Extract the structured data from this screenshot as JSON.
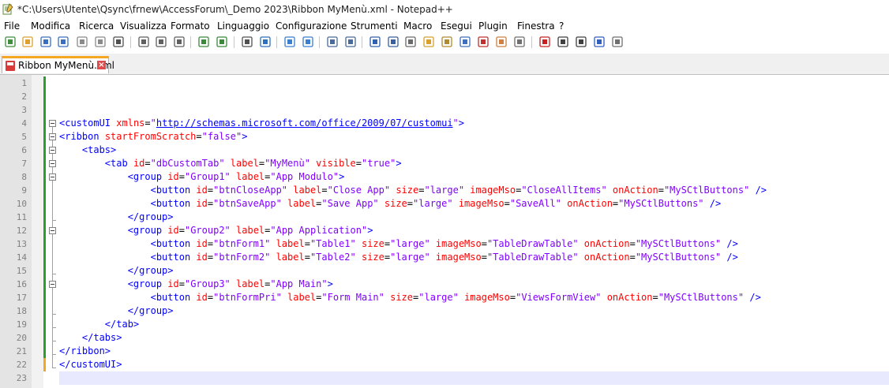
{
  "window": {
    "title": "*C:\\Users\\Utente\\Qsync\\frnew\\AccessForum\\_Demo 2023\\Ribbon MyMenù.xml - Notepad++"
  },
  "menu": [
    "File",
    "Modifica",
    "Ricerca",
    "Visualizza",
    "Formato",
    "Linguaggio",
    "Configurazione",
    "Strumenti",
    "Macro",
    "Esegui",
    "Plugin",
    "Finestra",
    "?"
  ],
  "toolbar": {
    "buttons": [
      "new-file-icon",
      "open-file-icon",
      "save-icon",
      "save-all-icon",
      "close-icon",
      "close-all-icon",
      "print-icon",
      "cut-icon",
      "copy-icon",
      "paste-icon",
      "undo-icon",
      "redo-icon",
      "find-icon",
      "replace-icon",
      "zoom-in-icon",
      "zoom-out-icon",
      "sync-vertical-icon",
      "sync-horizontal-icon",
      "word-wrap-icon",
      "show-all-chars-icon",
      "indent-guide-icon",
      "udl-icon",
      "doc-map-icon",
      "doc-list-icon",
      "function-list-icon",
      "folder-workspace-icon",
      "monitoring-icon",
      "record-macro-icon",
      "stop-record-icon",
      "play-macro-icon",
      "run-macro-multiple-icon",
      "save-macro-icon"
    ]
  },
  "tab": {
    "label": "Ribbon MyMenù.xml"
  },
  "editor": {
    "current_line": 23,
    "lines": [
      {
        "n": "1",
        "tokens": []
      },
      {
        "n": "2",
        "tokens": []
      },
      {
        "n": "3",
        "tokens": []
      },
      {
        "n": "4",
        "tokens": [
          {
            "t": "tag",
            "v": "<customUI"
          },
          {
            "t": "pun",
            "v": " "
          },
          {
            "t": "attr",
            "v": "xmlns"
          },
          {
            "t": "pun",
            "v": "="
          },
          {
            "t": "val",
            "v": "\""
          },
          {
            "t": "url",
            "v": "http://schemas.microsoft.com/office/2009/07/customui"
          },
          {
            "t": "val",
            "v": "\""
          },
          {
            "t": "tag",
            "v": ">"
          }
        ]
      },
      {
        "n": "5",
        "tokens": [
          {
            "t": "tag",
            "v": "<ribbon"
          },
          {
            "t": "pun",
            "v": " "
          },
          {
            "t": "attr",
            "v": "startFromScratch"
          },
          {
            "t": "pun",
            "v": "="
          },
          {
            "t": "val",
            "v": "\"false\""
          },
          {
            "t": "tag",
            "v": ">"
          }
        ]
      },
      {
        "n": "6",
        "tokens": [
          {
            "t": "pun",
            "v": "    "
          },
          {
            "t": "tag",
            "v": "<tabs>"
          }
        ]
      },
      {
        "n": "7",
        "tokens": [
          {
            "t": "pun",
            "v": "        "
          },
          {
            "t": "tag",
            "v": "<tab"
          },
          {
            "t": "pun",
            "v": " "
          },
          {
            "t": "attr",
            "v": "id"
          },
          {
            "t": "pun",
            "v": "="
          },
          {
            "t": "val",
            "v": "\"dbCustomTab\""
          },
          {
            "t": "pun",
            "v": " "
          },
          {
            "t": "attr",
            "v": "label"
          },
          {
            "t": "pun",
            "v": "="
          },
          {
            "t": "val",
            "v": "\"MyMenù\""
          },
          {
            "t": "pun",
            "v": " "
          },
          {
            "t": "attr",
            "v": "visible"
          },
          {
            "t": "pun",
            "v": "="
          },
          {
            "t": "val",
            "v": "\"true\""
          },
          {
            "t": "tag",
            "v": ">"
          }
        ]
      },
      {
        "n": "8",
        "tokens": [
          {
            "t": "pun",
            "v": "            "
          },
          {
            "t": "tag",
            "v": "<group"
          },
          {
            "t": "pun",
            "v": " "
          },
          {
            "t": "attr",
            "v": "id"
          },
          {
            "t": "pun",
            "v": "="
          },
          {
            "t": "val",
            "v": "\"Group1\""
          },
          {
            "t": "pun",
            "v": " "
          },
          {
            "t": "attr",
            "v": "label"
          },
          {
            "t": "pun",
            "v": "="
          },
          {
            "t": "val",
            "v": "\"App Modulo\""
          },
          {
            "t": "tag",
            "v": ">"
          }
        ]
      },
      {
        "n": "9",
        "tokens": [
          {
            "t": "pun",
            "v": "                "
          },
          {
            "t": "tag",
            "v": "<button"
          },
          {
            "t": "pun",
            "v": " "
          },
          {
            "t": "attr",
            "v": "id"
          },
          {
            "t": "pun",
            "v": "="
          },
          {
            "t": "val",
            "v": "\"btnCloseApp\""
          },
          {
            "t": "pun",
            "v": " "
          },
          {
            "t": "attr",
            "v": "label"
          },
          {
            "t": "pun",
            "v": "="
          },
          {
            "t": "val",
            "v": "\"Close App\""
          },
          {
            "t": "pun",
            "v": " "
          },
          {
            "t": "attr",
            "v": "size"
          },
          {
            "t": "pun",
            "v": "="
          },
          {
            "t": "val",
            "v": "\"large\""
          },
          {
            "t": "pun",
            "v": " "
          },
          {
            "t": "attr",
            "v": "imageMso"
          },
          {
            "t": "pun",
            "v": "="
          },
          {
            "t": "val",
            "v": "\"CloseAllItems\""
          },
          {
            "t": "pun",
            "v": " "
          },
          {
            "t": "attr",
            "v": "onAction"
          },
          {
            "t": "pun",
            "v": "="
          },
          {
            "t": "val",
            "v": "\"MySCtlButtons\""
          },
          {
            "t": "pun",
            "v": " "
          },
          {
            "t": "tag",
            "v": "/>"
          }
        ]
      },
      {
        "n": "10",
        "tokens": [
          {
            "t": "pun",
            "v": "                "
          },
          {
            "t": "tag",
            "v": "<button"
          },
          {
            "t": "pun",
            "v": " "
          },
          {
            "t": "attr",
            "v": "id"
          },
          {
            "t": "pun",
            "v": "="
          },
          {
            "t": "val",
            "v": "\"btnSaveApp\""
          },
          {
            "t": "pun",
            "v": " "
          },
          {
            "t": "attr",
            "v": "label"
          },
          {
            "t": "pun",
            "v": "="
          },
          {
            "t": "val",
            "v": "\"Save App\""
          },
          {
            "t": "pun",
            "v": " "
          },
          {
            "t": "attr",
            "v": "size"
          },
          {
            "t": "pun",
            "v": "="
          },
          {
            "t": "val",
            "v": "\"large\""
          },
          {
            "t": "pun",
            "v": " "
          },
          {
            "t": "attr",
            "v": "imageMso"
          },
          {
            "t": "pun",
            "v": "="
          },
          {
            "t": "val",
            "v": "\"SaveAll\""
          },
          {
            "t": "pun",
            "v": " "
          },
          {
            "t": "attr",
            "v": "onAction"
          },
          {
            "t": "pun",
            "v": "="
          },
          {
            "t": "val",
            "v": "\"MySCtlButtons\""
          },
          {
            "t": "pun",
            "v": " "
          },
          {
            "t": "tag",
            "v": "/>"
          }
        ]
      },
      {
        "n": "11",
        "tokens": [
          {
            "t": "pun",
            "v": "            "
          },
          {
            "t": "tag",
            "v": "</group>"
          }
        ]
      },
      {
        "n": "12",
        "tokens": [
          {
            "t": "pun",
            "v": "            "
          },
          {
            "t": "tag",
            "v": "<group"
          },
          {
            "t": "pun",
            "v": " "
          },
          {
            "t": "attr",
            "v": "id"
          },
          {
            "t": "pun",
            "v": "="
          },
          {
            "t": "val",
            "v": "\"Group2\""
          },
          {
            "t": "pun",
            "v": " "
          },
          {
            "t": "attr",
            "v": "label"
          },
          {
            "t": "pun",
            "v": "="
          },
          {
            "t": "val",
            "v": "\"App Application\""
          },
          {
            "t": "tag",
            "v": ">"
          }
        ]
      },
      {
        "n": "13",
        "tokens": [
          {
            "t": "pun",
            "v": "                "
          },
          {
            "t": "tag",
            "v": "<button"
          },
          {
            "t": "pun",
            "v": " "
          },
          {
            "t": "attr",
            "v": "id"
          },
          {
            "t": "pun",
            "v": "="
          },
          {
            "t": "val",
            "v": "\"btnForm1\""
          },
          {
            "t": "pun",
            "v": " "
          },
          {
            "t": "attr",
            "v": "label"
          },
          {
            "t": "pun",
            "v": "="
          },
          {
            "t": "val",
            "v": "\"Table1\""
          },
          {
            "t": "pun",
            "v": " "
          },
          {
            "t": "attr",
            "v": "size"
          },
          {
            "t": "pun",
            "v": "="
          },
          {
            "t": "val",
            "v": "\"large\""
          },
          {
            "t": "pun",
            "v": " "
          },
          {
            "t": "attr",
            "v": "imageMso"
          },
          {
            "t": "pun",
            "v": "="
          },
          {
            "t": "val",
            "v": "\"TableDrawTable\""
          },
          {
            "t": "pun",
            "v": " "
          },
          {
            "t": "attr",
            "v": "onAction"
          },
          {
            "t": "pun",
            "v": "="
          },
          {
            "t": "val",
            "v": "\"MySCtlButtons\""
          },
          {
            "t": "pun",
            "v": " "
          },
          {
            "t": "tag",
            "v": "/>"
          }
        ]
      },
      {
        "n": "14",
        "tokens": [
          {
            "t": "pun",
            "v": "                "
          },
          {
            "t": "tag",
            "v": "<button"
          },
          {
            "t": "pun",
            "v": " "
          },
          {
            "t": "attr",
            "v": "id"
          },
          {
            "t": "pun",
            "v": "="
          },
          {
            "t": "val",
            "v": "\"btnForm2\""
          },
          {
            "t": "pun",
            "v": " "
          },
          {
            "t": "attr",
            "v": "label"
          },
          {
            "t": "pun",
            "v": "="
          },
          {
            "t": "val",
            "v": "\"Table2\""
          },
          {
            "t": "pun",
            "v": " "
          },
          {
            "t": "attr",
            "v": "size"
          },
          {
            "t": "pun",
            "v": "="
          },
          {
            "t": "val",
            "v": "\"large\""
          },
          {
            "t": "pun",
            "v": " "
          },
          {
            "t": "attr",
            "v": "imageMso"
          },
          {
            "t": "pun",
            "v": "="
          },
          {
            "t": "val",
            "v": "\"TableDrawTable\""
          },
          {
            "t": "pun",
            "v": " "
          },
          {
            "t": "attr",
            "v": "onAction"
          },
          {
            "t": "pun",
            "v": "="
          },
          {
            "t": "val",
            "v": "\"MySCtlButtons\""
          },
          {
            "t": "pun",
            "v": " "
          },
          {
            "t": "tag",
            "v": "/>"
          }
        ]
      },
      {
        "n": "15",
        "tokens": [
          {
            "t": "pun",
            "v": "            "
          },
          {
            "t": "tag",
            "v": "</group>"
          }
        ]
      },
      {
        "n": "16",
        "tokens": [
          {
            "t": "pun",
            "v": "            "
          },
          {
            "t": "tag",
            "v": "<group"
          },
          {
            "t": "pun",
            "v": " "
          },
          {
            "t": "attr",
            "v": "id"
          },
          {
            "t": "pun",
            "v": "="
          },
          {
            "t": "val",
            "v": "\"Group3\""
          },
          {
            "t": "pun",
            "v": " "
          },
          {
            "t": "attr",
            "v": "label"
          },
          {
            "t": "pun",
            "v": "="
          },
          {
            "t": "val",
            "v": "\"App Main\""
          },
          {
            "t": "tag",
            "v": ">"
          }
        ]
      },
      {
        "n": "17",
        "tokens": [
          {
            "t": "pun",
            "v": "                "
          },
          {
            "t": "tag",
            "v": "<button"
          },
          {
            "t": "pun",
            "v": " "
          },
          {
            "t": "attr",
            "v": "id"
          },
          {
            "t": "pun",
            "v": "="
          },
          {
            "t": "val",
            "v": "\"btnFormPri\""
          },
          {
            "t": "pun",
            "v": " "
          },
          {
            "t": "attr",
            "v": "label"
          },
          {
            "t": "pun",
            "v": "="
          },
          {
            "t": "val",
            "v": "\"Form Main\""
          },
          {
            "t": "pun",
            "v": " "
          },
          {
            "t": "attr",
            "v": "size"
          },
          {
            "t": "pun",
            "v": "="
          },
          {
            "t": "val",
            "v": "\"large\""
          },
          {
            "t": "pun",
            "v": " "
          },
          {
            "t": "attr",
            "v": "imageMso"
          },
          {
            "t": "pun",
            "v": "="
          },
          {
            "t": "val",
            "v": "\"ViewsFormView\""
          },
          {
            "t": "pun",
            "v": " "
          },
          {
            "t": "attr",
            "v": "onAction"
          },
          {
            "t": "pun",
            "v": "="
          },
          {
            "t": "val",
            "v": "\"MySCtlButtons\""
          },
          {
            "t": "pun",
            "v": " "
          },
          {
            "t": "tag",
            "v": "/>"
          }
        ]
      },
      {
        "n": "18",
        "tokens": [
          {
            "t": "pun",
            "v": "            "
          },
          {
            "t": "tag",
            "v": "</group>"
          }
        ]
      },
      {
        "n": "19",
        "tokens": [
          {
            "t": "pun",
            "v": "        "
          },
          {
            "t": "tag",
            "v": "</tab>"
          }
        ]
      },
      {
        "n": "20",
        "tokens": [
          {
            "t": "pun",
            "v": "    "
          },
          {
            "t": "tag",
            "v": "</tabs>"
          }
        ]
      },
      {
        "n": "21",
        "tokens": [
          {
            "t": "tag",
            "v": "</ribbon>"
          }
        ]
      },
      {
        "n": "22",
        "tokens": [
          {
            "t": "tag",
            "v": "</customUI>"
          }
        ]
      },
      {
        "n": "23",
        "tokens": []
      }
    ]
  },
  "colors": {
    "tag": "#0000ff",
    "attribute": "#ff0000",
    "value": "#8000ff",
    "changed_line_bar": "#2aa12a",
    "unsaved_line_bar": "#f5a623",
    "caret_line": "#e8e8ff"
  }
}
